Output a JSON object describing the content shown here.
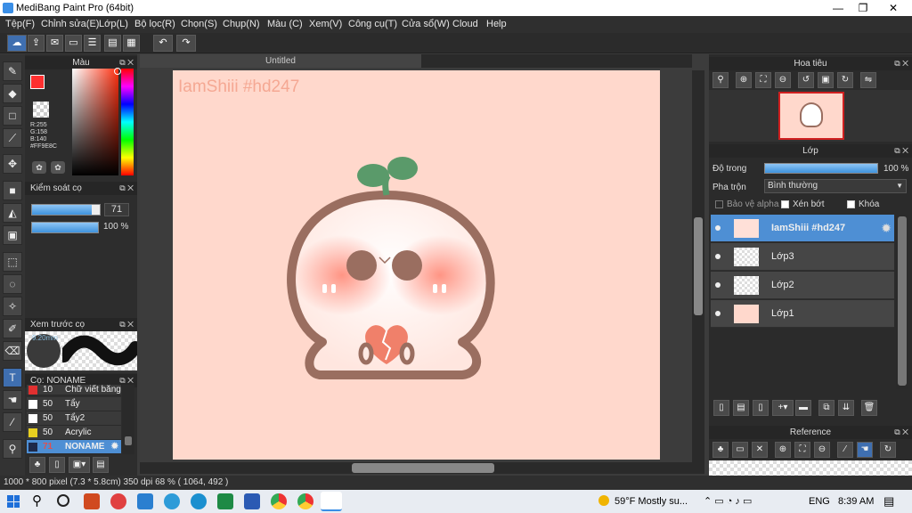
{
  "window": {
    "title": "MediBang Paint Pro (64bit)",
    "min": "—",
    "max": "❐",
    "close": "✕"
  },
  "menu": [
    "Tệp(F)",
    "Chỉnh sửa(E)",
    "Lớp(L)",
    "Bộ lọc(R)",
    "Chọn(S)",
    "Chụp(N)",
    "Màu (C)",
    "Xem(V)",
    "Công cụ(T)",
    "Cửa sổ(W)",
    "Cloud",
    "Help"
  ],
  "color_panel": {
    "title": "Màu",
    "r": "R:255",
    "g": "G:158",
    "b": "B:140",
    "hex": "#FF9E8C",
    "primary_color": "#ff9e8c"
  },
  "brush_control": {
    "title": "Kiểm soát cọ",
    "size": "71",
    "opacity": "100 %",
    "size_fraction": 0.88,
    "opacity_fraction": 1.0
  },
  "brush_preview": {
    "title": "Xem trước cọ",
    "size_label": "9.20mm"
  },
  "brush_list": {
    "title": "Cọ: NONAME",
    "items": [
      {
        "size": "10",
        "name": "Chữ viết bằng",
        "color": "#e03030"
      },
      {
        "size": "50",
        "name": "Tẩy",
        "color": "#ffffff"
      },
      {
        "size": "50",
        "name": "Tẩy2",
        "color": "#ffffff"
      },
      {
        "size": "50",
        "name": "Acrylic",
        "color": "#e8d020"
      },
      {
        "size": "71",
        "name": "NONAME",
        "color": "#1e2a4a",
        "selected": true
      }
    ]
  },
  "canvas": {
    "tab": "Untitled",
    "watermark": "IamShiii #hd247",
    "background": "#ffd8cc"
  },
  "navigator": {
    "title": "Hoa tiêu"
  },
  "layers_panel": {
    "title": "Lớp",
    "opacity_label": "Độ trong",
    "opacity_value": "100 %",
    "blend_label": "Pha trộn",
    "blend_value": "Bình thường",
    "protect_alpha": "Bảo vệ alpha",
    "clipping": "Xén bớt",
    "lock": "Khóa",
    "layers": [
      {
        "name": "IamShiii #hd247",
        "selected": true
      },
      {
        "name": "Lớp3"
      },
      {
        "name": "Lớp2"
      },
      {
        "name": "Lớp1"
      }
    ]
  },
  "reference": {
    "title": "Reference"
  },
  "status": {
    "text": "1000 * 800 pixel  (7.3 * 5.8cm)  350 dpi  68 %  ( 1064, 492 )"
  },
  "taskbar": {
    "weather": "59°F  Mostly su...",
    "lang": "ENG",
    "time": "8:39 AM"
  }
}
